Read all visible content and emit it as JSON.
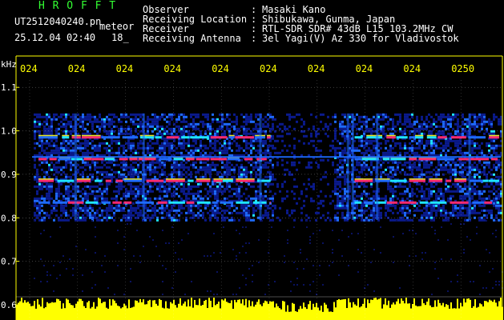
{
  "header": {
    "logo": "H R O F F T",
    "filename": "UT2512040240.pn",
    "mode": "meteor",
    "datetime": "25.12.04 02:40",
    "minute_marker": "18_",
    "fields": [
      {
        "label": "Observer",
        "value": "Masaki Kano"
      },
      {
        "label": "Receiving Location",
        "value": "Shibukawa, Gunma, Japan"
      },
      {
        "label": "Receiver",
        "value": "RTL-SDR SDR# 43dB L15 103.2MHz CW"
      },
      {
        "label": "Receiving Antenna",
        "value": "3el Yagi(V) Az 330 for Vladivostok"
      }
    ]
  },
  "chart_data": {
    "type": "heatmap",
    "ylabel": "kHz",
    "ylim": [
      0.6,
      1.15
    ],
    "yticks": [
      "1.1",
      "1.0",
      "0.9",
      "0.8",
      "0.7",
      "0.6"
    ],
    "xticks": [
      "024",
      "024",
      "024",
      "024",
      "024",
      "024",
      "024",
      "024",
      "024",
      "0250"
    ],
    "grid": true,
    "colors": {
      "background": "#000000",
      "noise": "#0a1a8c",
      "signal_low": "#1e6bff",
      "signal_mid": "#1ee6ff",
      "signal_high": "#ff2a6e",
      "grid": "#ffffff",
      "axis": "#ffff00",
      "level": "#ffff00"
    },
    "active_band_khz": [
      0.795,
      1.04
    ],
    "signal_lines_khz": [
      {
        "freq": 0.985,
        "strength": 1.0
      },
      {
        "freq": 0.935,
        "strength": 0.85
      },
      {
        "freq": 0.885,
        "strength": 0.8
      },
      {
        "freq": 0.835,
        "strength": 0.6
      }
    ],
    "carrier_khz": 0.94,
    "active_minutes": [
      [
        0.0,
        0.53
      ],
      [
        0.65,
        1.0
      ]
    ]
  }
}
